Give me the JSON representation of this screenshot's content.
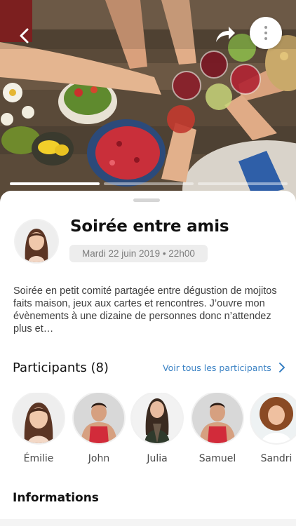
{
  "header": {
    "back_icon": "chevron-left-icon",
    "share_icon": "share-arrow-icon",
    "more_icon": "more-vertical-icon",
    "story_progress": {
      "segments": 3,
      "active_index": 0
    }
  },
  "event": {
    "title": "Soirée entre amis",
    "date": "Mardi 22 juin 2019 • 22h00",
    "description": "Soirée en petit comité partagée entre dégustion de mojitos faits maison, jeux aux cartes et rencontres. J’ouvre mon évènements à une dizaine de personnes donc n’attendez plus et…"
  },
  "participants": {
    "title": "Participants (8)",
    "see_all": "Voir tous les participants",
    "items": [
      {
        "name": "Émilie"
      },
      {
        "name": "John"
      },
      {
        "name": "Julia"
      },
      {
        "name": "Samuel"
      },
      {
        "name": "Sandri"
      }
    ]
  },
  "informations": {
    "title": "Informations"
  },
  "colors": {
    "link": "#3b82c4",
    "pill_bg": "#ededed",
    "text": "#111111"
  }
}
